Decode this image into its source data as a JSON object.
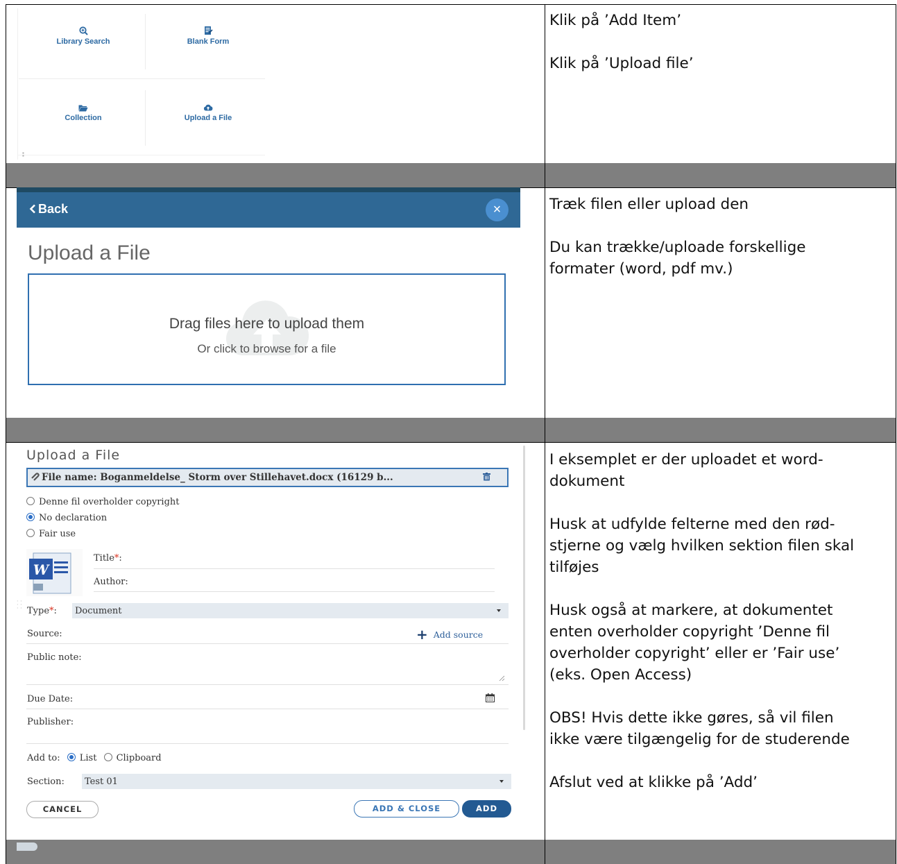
{
  "panel1": {
    "tiles": [
      {
        "label": "Library Search",
        "icon": "magnify-plus-icon"
      },
      {
        "label": "Blank Form",
        "icon": "edit-form-icon"
      },
      {
        "label": "Collection",
        "icon": "folder-open-icon"
      },
      {
        "label": "Upload a File",
        "icon": "cloud-upload-icon"
      }
    ],
    "notes": [
      "Klik på ’Add Item’",
      "Klik på ’Upload file’"
    ]
  },
  "panel2": {
    "back_label": "Back",
    "close_label": "×",
    "heading": "Upload a File",
    "drop_main": "Drag files here to upload them",
    "drop_sub": "Or click to browse for a file",
    "notes": [
      "Træk filen eller upload den",
      "Du kan trække/uploade forskellige",
      "formater (word, pdf mv.)"
    ]
  },
  "panel3": {
    "heading": "Upload a File",
    "file_name": "File name: Boganmeldelse_ Storm over Stillehavet.docx (16129 b...",
    "copyright_options": [
      {
        "label": "Denne fil overholder copyright",
        "selected": false
      },
      {
        "label": "No declaration",
        "selected": true
      },
      {
        "label": "Fair use",
        "selected": false
      }
    ],
    "title_label": "Title",
    "title_suffix": ":",
    "author_label": "Author:",
    "type_label": "Type",
    "type_suffix": ":",
    "type_value": "Document",
    "source_label": "Source:",
    "add_source_label": "Add source",
    "public_note_label": "Public note:",
    "due_date_label": "Due Date:",
    "publisher_label": "Publisher:",
    "add_to_label": "Add to:",
    "add_to_options": [
      {
        "label": "List",
        "selected": true
      },
      {
        "label": "Clipboard",
        "selected": false
      }
    ],
    "section_label": "Section:",
    "section_value": "Test 01",
    "cancel_label": "CANCEL",
    "add_close_label": "ADD & CLOSE",
    "add_label": "ADD",
    "required_mark": "*",
    "notes": {
      "n1a": "I eksemplet er der uploadet et word-",
      "n1b": "dokument",
      "n2a": "Husk at udfylde felterne med den rød-",
      "n2b": "stjerne og vælg hvilken sektion filen skal",
      "n2c": "tilføjes",
      "n3a": "Husk også at markere, at dokumentet",
      "n3b": "enten overholder copyright ’Denne fil",
      "n3c": "overholder copyright’ eller er ’Fair use’",
      "n3d": "(eks. Open Access)",
      "n4a": "OBS! Hvis dette ikke gøres, så vil filen",
      "n4b": "ikke være tilgængelig for de studerende",
      "n5": "Afslut ved at klikke på ’Add’"
    }
  },
  "colors": {
    "header_blue": "#2f6895",
    "accent_blue": "#2f6fb0",
    "required_red": "#d9321f",
    "separator_gray": "#7f7f7f"
  }
}
